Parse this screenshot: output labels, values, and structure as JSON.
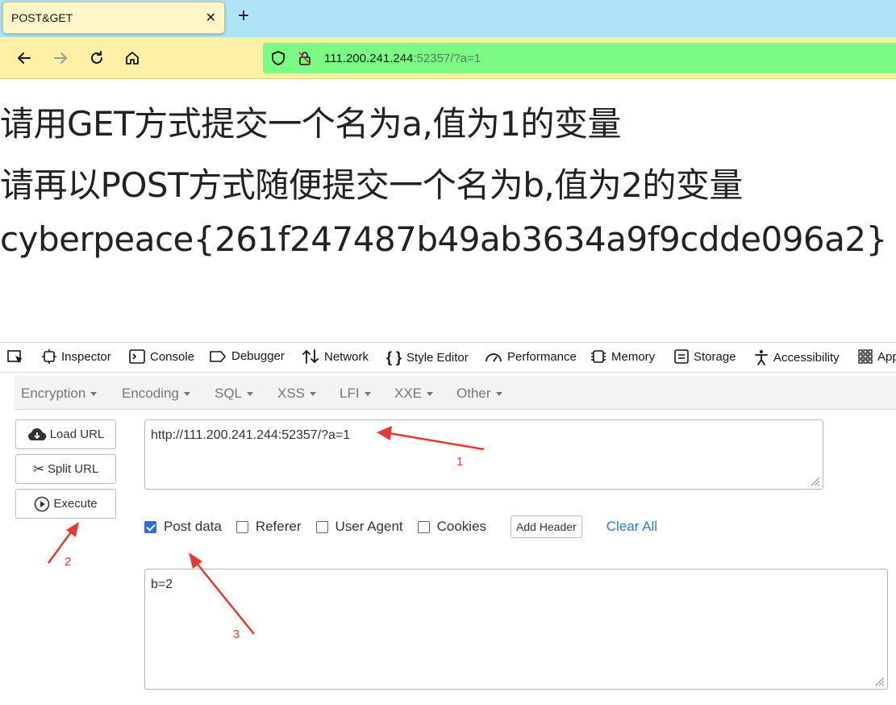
{
  "browser": {
    "tab_title": "POST&GET",
    "new_tab_icon": "plus-icon",
    "url_host": "111.200.241.244",
    "url_rest": ":52357/?a=1"
  },
  "page": {
    "line1": "请用GET方式提交一个名为a,值为1的变量",
    "line2": "请再以POST方式随便提交一个名为b,值为2的变量",
    "line3": "cyberpeace{261f247487b49ab3634a9f9cdde096a2}"
  },
  "devtools": {
    "tabs": [
      "Inspector",
      "Console",
      "Debugger",
      "Network",
      "Style Editor",
      "Performance",
      "Memory",
      "Storage",
      "Accessibility",
      "App"
    ]
  },
  "hackbar": {
    "menus": [
      "Encryption",
      "Encoding",
      "SQL",
      "XSS",
      "LFI",
      "XXE",
      "Other"
    ],
    "load_url": "Load URL",
    "split_url": "Split URL",
    "execute": "Execute",
    "url_value": "http://111.200.241.244:52357/?a=1",
    "checkboxes": {
      "post_data": "Post data",
      "referer": "Referer",
      "user_agent": "User Agent",
      "cookies": "Cookies"
    },
    "add_header": "Add Header",
    "clear_all": "Clear All",
    "post_value": "b=2"
  },
  "annotations": {
    "one": "1",
    "two": "2",
    "three": "3",
    "color": "#e53935"
  }
}
